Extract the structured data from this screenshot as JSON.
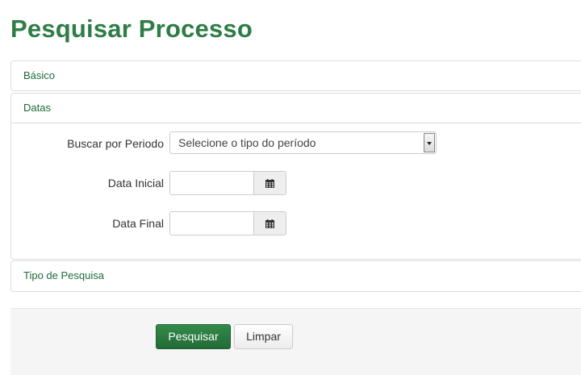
{
  "page": {
    "title": "Pesquisar Processo"
  },
  "panels": {
    "basico": {
      "label": "Básico"
    },
    "datas": {
      "label": "Datas",
      "fields": {
        "periodo": {
          "label": "Buscar por Periodo",
          "selected": "Selecione o tipo do período"
        },
        "data_inicial": {
          "label": "Data Inicial",
          "value": ""
        },
        "data_final": {
          "label": "Data Final",
          "value": ""
        }
      }
    },
    "tipo": {
      "label": "Tipo de Pesquisa"
    }
  },
  "actions": {
    "search_label": "Pesquisar",
    "clear_label": "Limpar"
  },
  "colors": {
    "accent": "#2e7d46",
    "primary_button": "#2b7a40"
  }
}
